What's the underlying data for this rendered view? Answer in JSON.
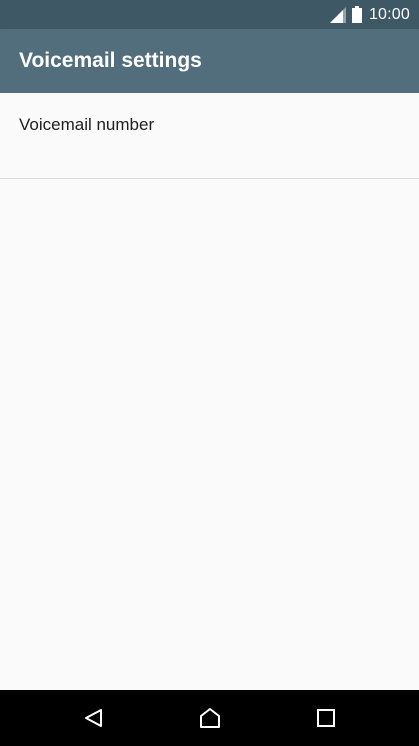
{
  "status_bar": {
    "time": "10:00",
    "icons": [
      "signal-icon",
      "battery-icon"
    ]
  },
  "app_bar": {
    "title": "Voicemail settings"
  },
  "settings": {
    "items": [
      {
        "label": "Voicemail number"
      }
    ]
  },
  "nav_bar": {
    "buttons": [
      "back-icon",
      "home-icon",
      "recent-apps-icon"
    ]
  },
  "colors": {
    "status_bar": "#3f5866",
    "app_bar": "#526d7c",
    "background": "#fafafa",
    "nav_bar": "#000000"
  }
}
